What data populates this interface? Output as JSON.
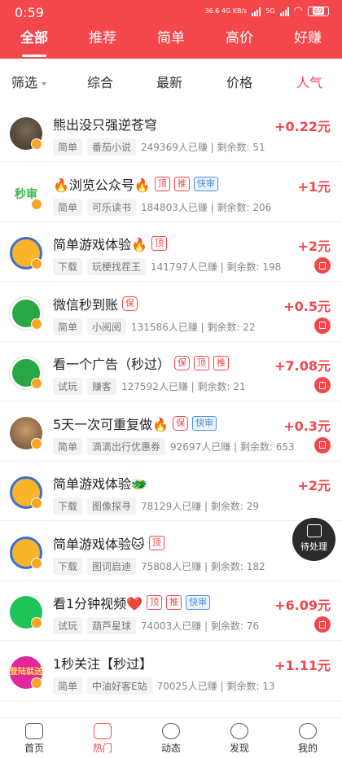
{
  "status": {
    "time": "0:59",
    "net": "36.6 4G KB/s",
    "sig": "5G",
    "battery": "69"
  },
  "tabs": [
    {
      "label": "全部",
      "active": true
    },
    {
      "label": "推荐"
    },
    {
      "label": "简单"
    },
    {
      "label": "高价"
    },
    {
      "label": "好赚"
    }
  ],
  "filters": {
    "filter": "筛选",
    "comprehensive": "综合",
    "newest": "最新",
    "price": "价格",
    "popular": "人气"
  },
  "tasks": [
    {
      "title": "熊出没只强逆苍穹",
      "type": "简单",
      "app": "番茄小说",
      "stats": "249369人已赚 | 剩余数: 51",
      "price": "+0.22元",
      "tags": []
    },
    {
      "title": "🔥浏览公众号🔥",
      "type": "简单",
      "app": "可乐读书",
      "stats": "184803人已赚 | 剩余数: 206",
      "price": "+1元",
      "tags": [
        "顶",
        "推",
        "快审"
      ]
    },
    {
      "title": "简单游戏体验🔥",
      "type": "下载",
      "app": "玩梗找茬王",
      "stats": "141797人已赚 | 剩余数: 198",
      "price": "+2元",
      "tags": [
        "顶"
      ]
    },
    {
      "title": "微信秒到账",
      "type": "简单",
      "app": "小阅阅",
      "stats": "131586人已赚 | 剩余数: 22",
      "price": "+0.5元",
      "tags": [
        "保"
      ]
    },
    {
      "title": "看一个广告（秒过）",
      "type": "试玩",
      "app": "赚客",
      "stats": "127592人已赚 | 剩余数: 21",
      "price": "+7.08元",
      "tags": [
        "保",
        "顶",
        "推"
      ]
    },
    {
      "title": "5天一次可重复做🔥",
      "type": "简单",
      "app": "滴滴出行优惠券",
      "stats": "92697人已赚 | 剩余数: 653",
      "price": "+0.3元",
      "tags": [
        "保",
        "快审"
      ]
    },
    {
      "title": "简单游戏体验🐲",
      "type": "下载",
      "app": "图像探寻",
      "stats": "78129人已赚 | 剩余数: 29",
      "price": "+2元",
      "tags": []
    },
    {
      "title": "简单游戏体验🐱",
      "type": "下载",
      "app": "图词启迪",
      "stats": "75808人已赚 | 剩余数: 182",
      "price": "",
      "tags": [
        "顶"
      ]
    },
    {
      "title": "看1分钟视频❤️",
      "type": "试玩",
      "app": "葫芦星球",
      "stats": "74003人已赚 | 剩余数: 76",
      "price": "+6.09元",
      "tags": [
        "顶",
        "推",
        "快审"
      ]
    },
    {
      "title": "1秒关注【秒过】",
      "type": "简单",
      "app": "中油好客E站",
      "stats": "70025人已赚 | 剩余数: 13",
      "price": "+1.11元",
      "tags": []
    }
  ],
  "avatar_texts": {
    "row1": "秒审",
    "row9": "登陆就送"
  },
  "float_button": "待处理",
  "bottom_nav": [
    {
      "label": "首页"
    },
    {
      "label": "热门",
      "active": true
    },
    {
      "label": "动态"
    },
    {
      "label": "发现"
    },
    {
      "label": "我的"
    }
  ],
  "colors": {
    "brand": "#f4474b",
    "fast": "#4d8fe6"
  }
}
